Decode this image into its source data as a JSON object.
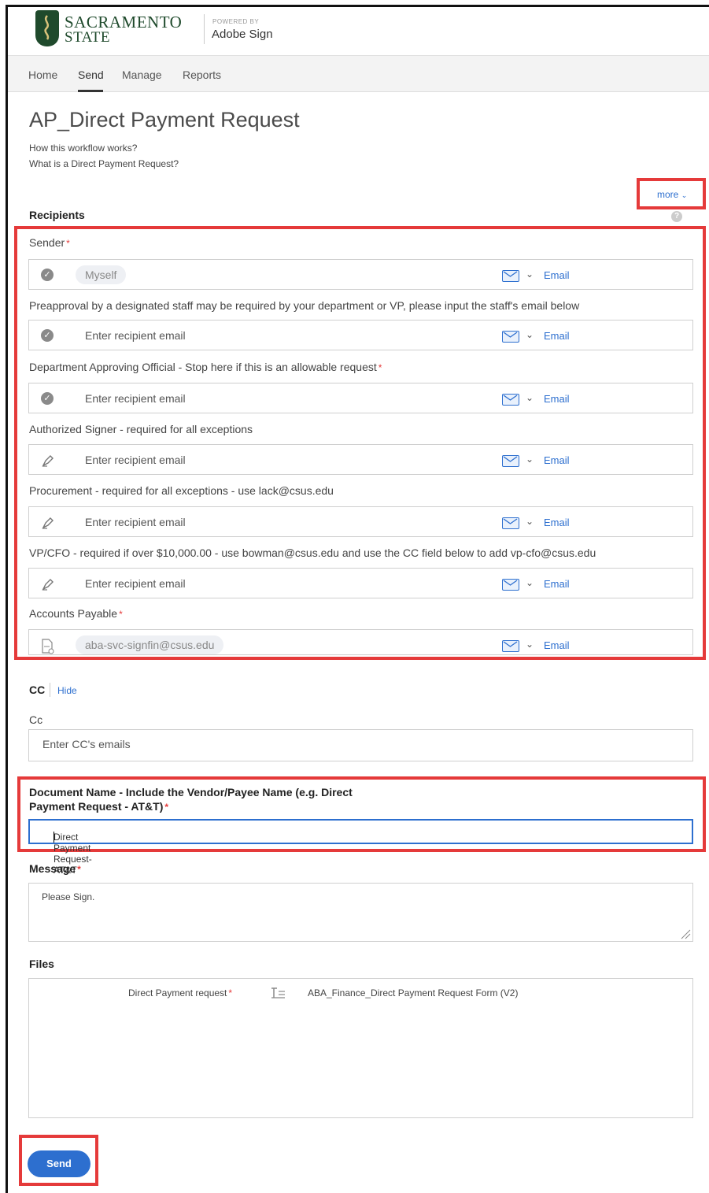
{
  "header": {
    "logo_line1": "SACRAMENTO",
    "logo_line2": "STATE",
    "powered_by": "POWERED BY",
    "product": "Adobe Sign"
  },
  "nav": {
    "items": [
      {
        "label": "Home"
      },
      {
        "label": "Send"
      },
      {
        "label": "Manage"
      },
      {
        "label": "Reports"
      }
    ],
    "active": "Send"
  },
  "page": {
    "title": "AP_Direct Payment Request",
    "help_links": [
      "How this workflow works?",
      "What is a Direct Payment Request?"
    ],
    "more_label": "more"
  },
  "recipients": {
    "section_label": "Recipients",
    "help_icon": "question-icon",
    "rows": [
      {
        "label": "Sender",
        "required": true,
        "icon": "check-circle-icon",
        "value": "Myself",
        "placeholder": "",
        "method": "Email"
      },
      {
        "label": "Preapproval by a designated staff may be required by your department or VP, please input the staff's email below",
        "required": false,
        "icon": "check-circle-icon",
        "value": "",
        "placeholder": "Enter recipient email",
        "method": "Email"
      },
      {
        "label": "Department Approving Official - Stop here if this is an allowable request",
        "required": true,
        "icon": "check-circle-icon",
        "value": "",
        "placeholder": "Enter recipient email",
        "method": "Email"
      },
      {
        "label": "Authorized Signer - required for all exceptions",
        "required": false,
        "icon": "pen-icon",
        "value": "",
        "placeholder": "Enter recipient email",
        "method": "Email"
      },
      {
        "label": "Procurement - required for all exceptions - use lack@csus.edu",
        "required": false,
        "icon": "pen-icon",
        "value": "",
        "placeholder": "Enter recipient email",
        "method": "Email"
      },
      {
        "label": "VP/CFO - required if over $10,000.00 - use bowman@csus.edu and use the CC field below to add vp-cfo@csus.edu",
        "required": false,
        "icon": "pen-icon",
        "value": "",
        "placeholder": "Enter recipient email",
        "method": "Email"
      },
      {
        "label": "Accounts Payable",
        "required": true,
        "icon": "form-fill-icon",
        "value": "aba-svc-signfin@csus.edu",
        "placeholder": "",
        "method": "Email"
      }
    ]
  },
  "cc": {
    "label": "CC",
    "hide_label": "Hide",
    "field_label": "Cc",
    "placeholder": "Enter CC's emails"
  },
  "document_name": {
    "label": "Document Name - Include the Vendor/Payee Name (e.g. Direct Payment Request - AT&T)",
    "value": "Direct Payment Request- AT&T"
  },
  "message": {
    "label": "Message",
    "value": "Please Sign."
  },
  "files": {
    "label": "Files",
    "items": [
      {
        "name": "Direct Payment request",
        "document": "ABA_Finance_Direct Payment Request Form (V2)"
      }
    ]
  },
  "send_button": "Send",
  "colors": {
    "brand_green": "#1f4a2c",
    "link_blue": "#2d6fcf",
    "highlight_red": "#e53a3a"
  }
}
